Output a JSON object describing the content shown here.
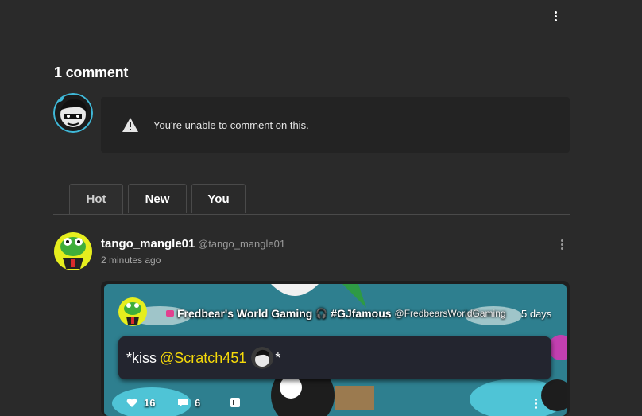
{
  "comments": {
    "count_label": "1 comment",
    "notice_text": "You're unable to comment on this."
  },
  "tabs": [
    {
      "label": "Hot",
      "active": true
    },
    {
      "label": "New",
      "active": false
    },
    {
      "label": "You",
      "active": false
    }
  ],
  "comment": {
    "username": "tango_mangle01",
    "handle": "@tango_mangle01",
    "time": "2 minutes ago",
    "embed": {
      "title_prefix": "Fredbear's World Gaming",
      "title_suffix": "#GJfamous",
      "handle": "@FredbearsWorldGaming",
      "time": "5 days",
      "message_prefix": "*kiss",
      "mention": "@Scratch451",
      "message_suffix": "*",
      "likes": "16",
      "replies": "6"
    }
  },
  "colors": {
    "background": "#2a2a2a",
    "panel": "#232323",
    "mention": "#f5d90a"
  }
}
